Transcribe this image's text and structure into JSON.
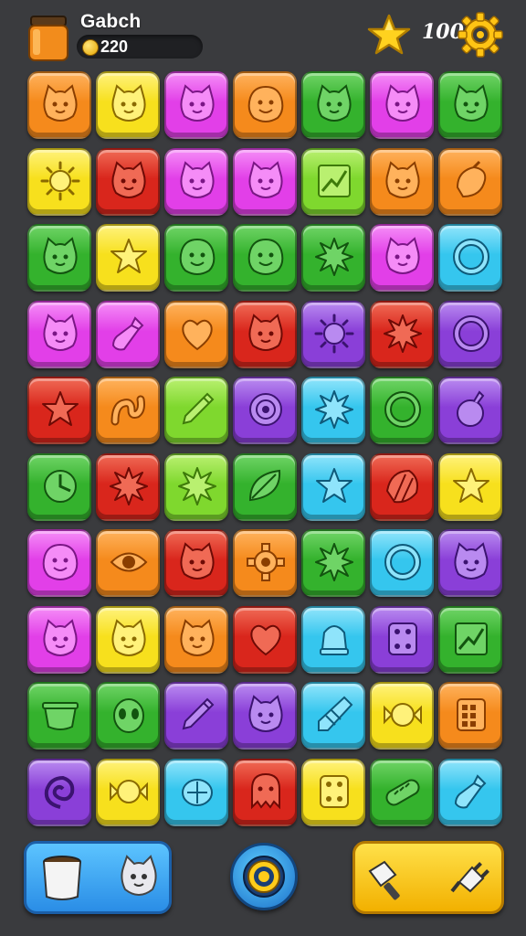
{
  "header": {
    "title": "Gabch",
    "coins": "220",
    "moves": "100",
    "jar_icon": "honey-jar-icon",
    "star_icon": "star-icon",
    "settings_icon": "gear-icon"
  },
  "colors": {
    "orange": "#f58a1c",
    "yellow": "#f7e01d",
    "magenta": "#e23fe8",
    "green": "#34b22d",
    "red": "#d9261c",
    "cyan": "#35c6ee",
    "purple": "#8a3fd8",
    "lime": "#7fd82e"
  },
  "board": {
    "rows": [
      [
        {
          "color": "orange",
          "icon": "cat-face"
        },
        {
          "color": "yellow",
          "icon": "cat-face"
        },
        {
          "color": "magenta",
          "icon": "cat-face"
        },
        {
          "color": "orange",
          "icon": "smile-face"
        },
        {
          "color": "green",
          "icon": "cat-face"
        },
        {
          "color": "magenta",
          "icon": "cat-face"
        },
        {
          "color": "green",
          "icon": "cat-face"
        }
      ],
      [
        {
          "color": "yellow",
          "icon": "sun"
        },
        {
          "color": "red",
          "icon": "cat-face"
        },
        {
          "color": "magenta",
          "icon": "cat-face"
        },
        {
          "color": "magenta",
          "icon": "cat-face"
        },
        {
          "color": "lime",
          "icon": "chart"
        },
        {
          "color": "orange",
          "icon": "cat-face"
        },
        {
          "color": "orange",
          "icon": "berry"
        }
      ],
      [
        {
          "color": "green",
          "icon": "cat-face"
        },
        {
          "color": "yellow",
          "icon": "star"
        },
        {
          "color": "green",
          "icon": "smile-face"
        },
        {
          "color": "green",
          "icon": "smile-face"
        },
        {
          "color": "green",
          "icon": "burst"
        },
        {
          "color": "magenta",
          "icon": "cat-face"
        },
        {
          "color": "cyan",
          "icon": "ring"
        }
      ],
      [
        {
          "color": "magenta",
          "icon": "cat-face"
        },
        {
          "color": "magenta",
          "icon": "bottle"
        },
        {
          "color": "orange",
          "icon": "heart"
        },
        {
          "color": "red",
          "icon": "cat-face"
        },
        {
          "color": "purple",
          "icon": "sun"
        },
        {
          "color": "red",
          "icon": "burst"
        },
        {
          "color": "purple",
          "icon": "ring"
        }
      ],
      [
        {
          "color": "red",
          "icon": "star"
        },
        {
          "color": "orange",
          "icon": "worm"
        },
        {
          "color": "lime",
          "icon": "pencil"
        },
        {
          "color": "purple",
          "icon": "target"
        },
        {
          "color": "cyan",
          "icon": "burst"
        },
        {
          "color": "green",
          "icon": "ring"
        },
        {
          "color": "purple",
          "icon": "potion"
        }
      ],
      [
        {
          "color": "green",
          "icon": "clock"
        },
        {
          "color": "red",
          "icon": "burst"
        },
        {
          "color": "lime",
          "icon": "burst"
        },
        {
          "color": "green",
          "icon": "leaf"
        },
        {
          "color": "cyan",
          "icon": "star"
        },
        {
          "color": "red",
          "icon": "shell"
        },
        {
          "color": "yellow",
          "icon": "star"
        }
      ],
      [
        {
          "color": "magenta",
          "icon": "smile-face"
        },
        {
          "color": "orange",
          "icon": "eye"
        },
        {
          "color": "red",
          "icon": "cat-face"
        },
        {
          "color": "orange",
          "icon": "gear"
        },
        {
          "color": "green",
          "icon": "burst"
        },
        {
          "color": "cyan",
          "icon": "ring"
        },
        {
          "color": "purple",
          "icon": "cat-face"
        }
      ],
      [
        {
          "color": "magenta",
          "icon": "cat-face"
        },
        {
          "color": "yellow",
          "icon": "cat-face"
        },
        {
          "color": "orange",
          "icon": "cat-face"
        },
        {
          "color": "red",
          "icon": "heart"
        },
        {
          "color": "cyan",
          "icon": "bell"
        },
        {
          "color": "purple",
          "icon": "dice"
        },
        {
          "color": "green",
          "icon": "chart"
        }
      ],
      [
        {
          "color": "green",
          "icon": "bowl"
        },
        {
          "color": "green",
          "icon": "alien"
        },
        {
          "color": "purple",
          "icon": "pencil"
        },
        {
          "color": "purple",
          "icon": "cat-face"
        },
        {
          "color": "cyan",
          "icon": "kite"
        },
        {
          "color": "yellow",
          "icon": "candy"
        },
        {
          "color": "orange",
          "icon": "grid"
        }
      ],
      [
        {
          "color": "purple",
          "icon": "swirl"
        },
        {
          "color": "yellow",
          "icon": "candy"
        },
        {
          "color": "cyan",
          "icon": "turtle"
        },
        {
          "color": "red",
          "icon": "ghost"
        },
        {
          "color": "yellow",
          "icon": "dice"
        },
        {
          "color": "green",
          "icon": "pickle"
        },
        {
          "color": "cyan",
          "icon": "bottle"
        }
      ]
    ]
  },
  "footer": {
    "left_button_icons": [
      "cup-icon",
      "cat-face-icon"
    ],
    "center_button_icon": "target-icon",
    "right_button_icons": [
      "hammer-icon",
      "plug-icon"
    ]
  }
}
